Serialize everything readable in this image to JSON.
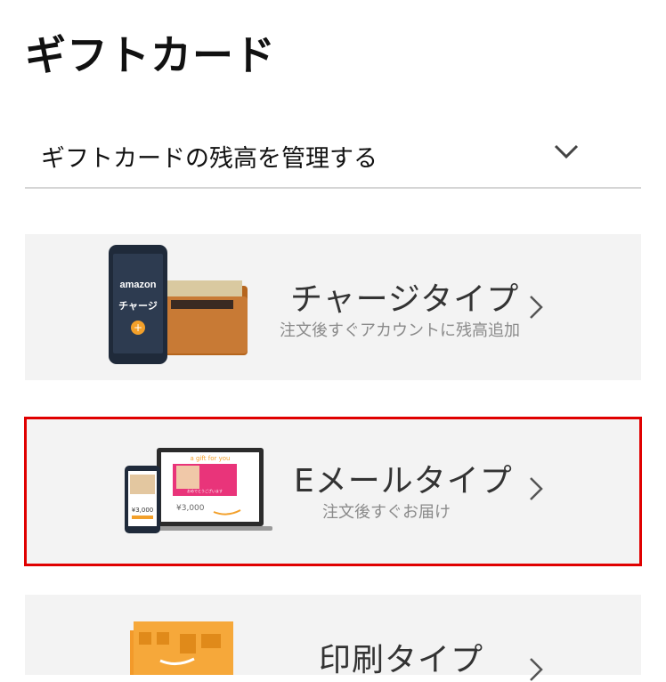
{
  "page": {
    "title": "ギフトカード"
  },
  "accordion": {
    "label": "ギフトカードの残高を管理する",
    "icon": "chevron-down-icon"
  },
  "cards": [
    {
      "title": "チャージタイプ",
      "subtitle": "注文後すぐアカウントに残高追加",
      "illustration": {
        "phone_brand": "amazon",
        "phone_text": "チャージ",
        "plus": "+"
      }
    },
    {
      "title": "Eメールタイプ",
      "subtitle": "注文後すぐお届け",
      "illustration": {
        "tagline": "a gift for you",
        "price_laptop": "¥3,000",
        "price_phone": "¥3,000",
        "photo_caption": "おめでとうございます"
      }
    },
    {
      "title": "印刷タイプ",
      "subtitle": "",
      "illustration": {}
    }
  ],
  "colors": {
    "highlight": "#e00000",
    "card_bg": "#f3f3f3",
    "amazon_orange": "#f3a02a"
  }
}
